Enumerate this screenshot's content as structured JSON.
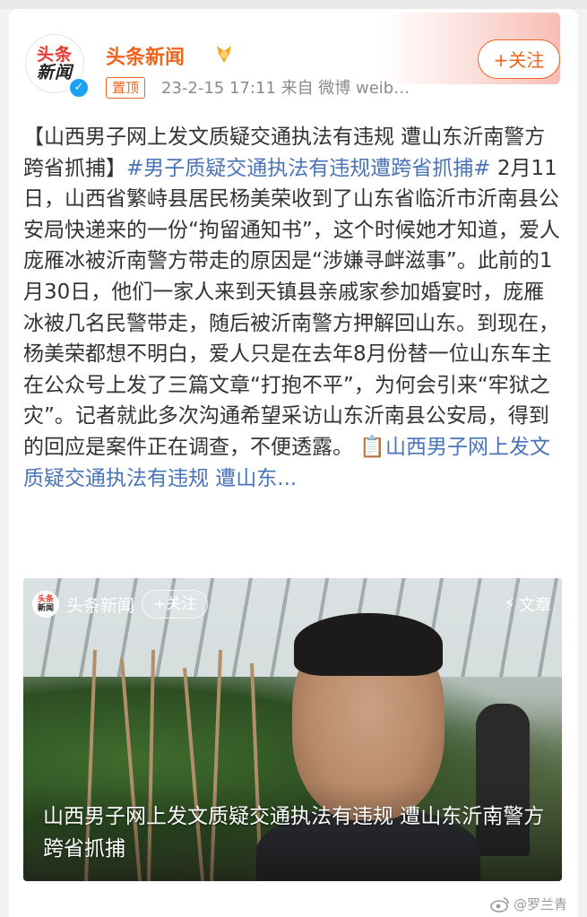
{
  "author": {
    "avatar_line1": "头条",
    "avatar_line2": "新闻",
    "name": "头条新闻",
    "follow_label": "+关注"
  },
  "meta": {
    "pinned_label": "置顶",
    "time_source": "23-2-15 17:11  来自 微博 weib…"
  },
  "post": {
    "title_bracket": "【山西男子网上发文质疑交通执法有违规 遭山东沂南警方跨省抓捕】",
    "hashtag": "#男子质疑交通执法有违规遭跨省抓捕#",
    "body": " 2月11日，山西省繁峙县居民杨美荣收到了山东省临沂市沂南县公安局快递来的一份“拘留通知书”，这个时候她才知道，爱人庞雁冰被沂南警方带走的原因是“涉嫌寻衅滋事”。此前的1月30日，他们一家人来到天镇县亲戚家参加婚宴时，庞雁冰被几名民警带走，随后被沂南警方押解回山东。到现在，杨美荣都想不明白，爱人只是在去年8月份替一位山东车主在公众号上发了三篇文章“打抱不平”，为何会引来“牢狱之灾”。记者就此多次沟通希望采访山东沂南县公安局，得到的回应是案件正在调查，不便透露。",
    "link_icon": "📋",
    "link_text": "山西男子网上发文质疑交通执法有违规 遭山东..."
  },
  "media": {
    "source_logo_line1": "头条",
    "source_logo_line2": "新闻",
    "source_name": "头条新闻",
    "follow_label": "+关注",
    "type_label": "文章",
    "caption": "山西男子网上发文质疑交通执法有违规 遭山东沂南警方跨省抓捕"
  },
  "watermark": {
    "text": "@罗兰青"
  },
  "colors": {
    "accent": "#f0651d",
    "link": "#4a74b8",
    "verified": "#1aa3f4"
  }
}
